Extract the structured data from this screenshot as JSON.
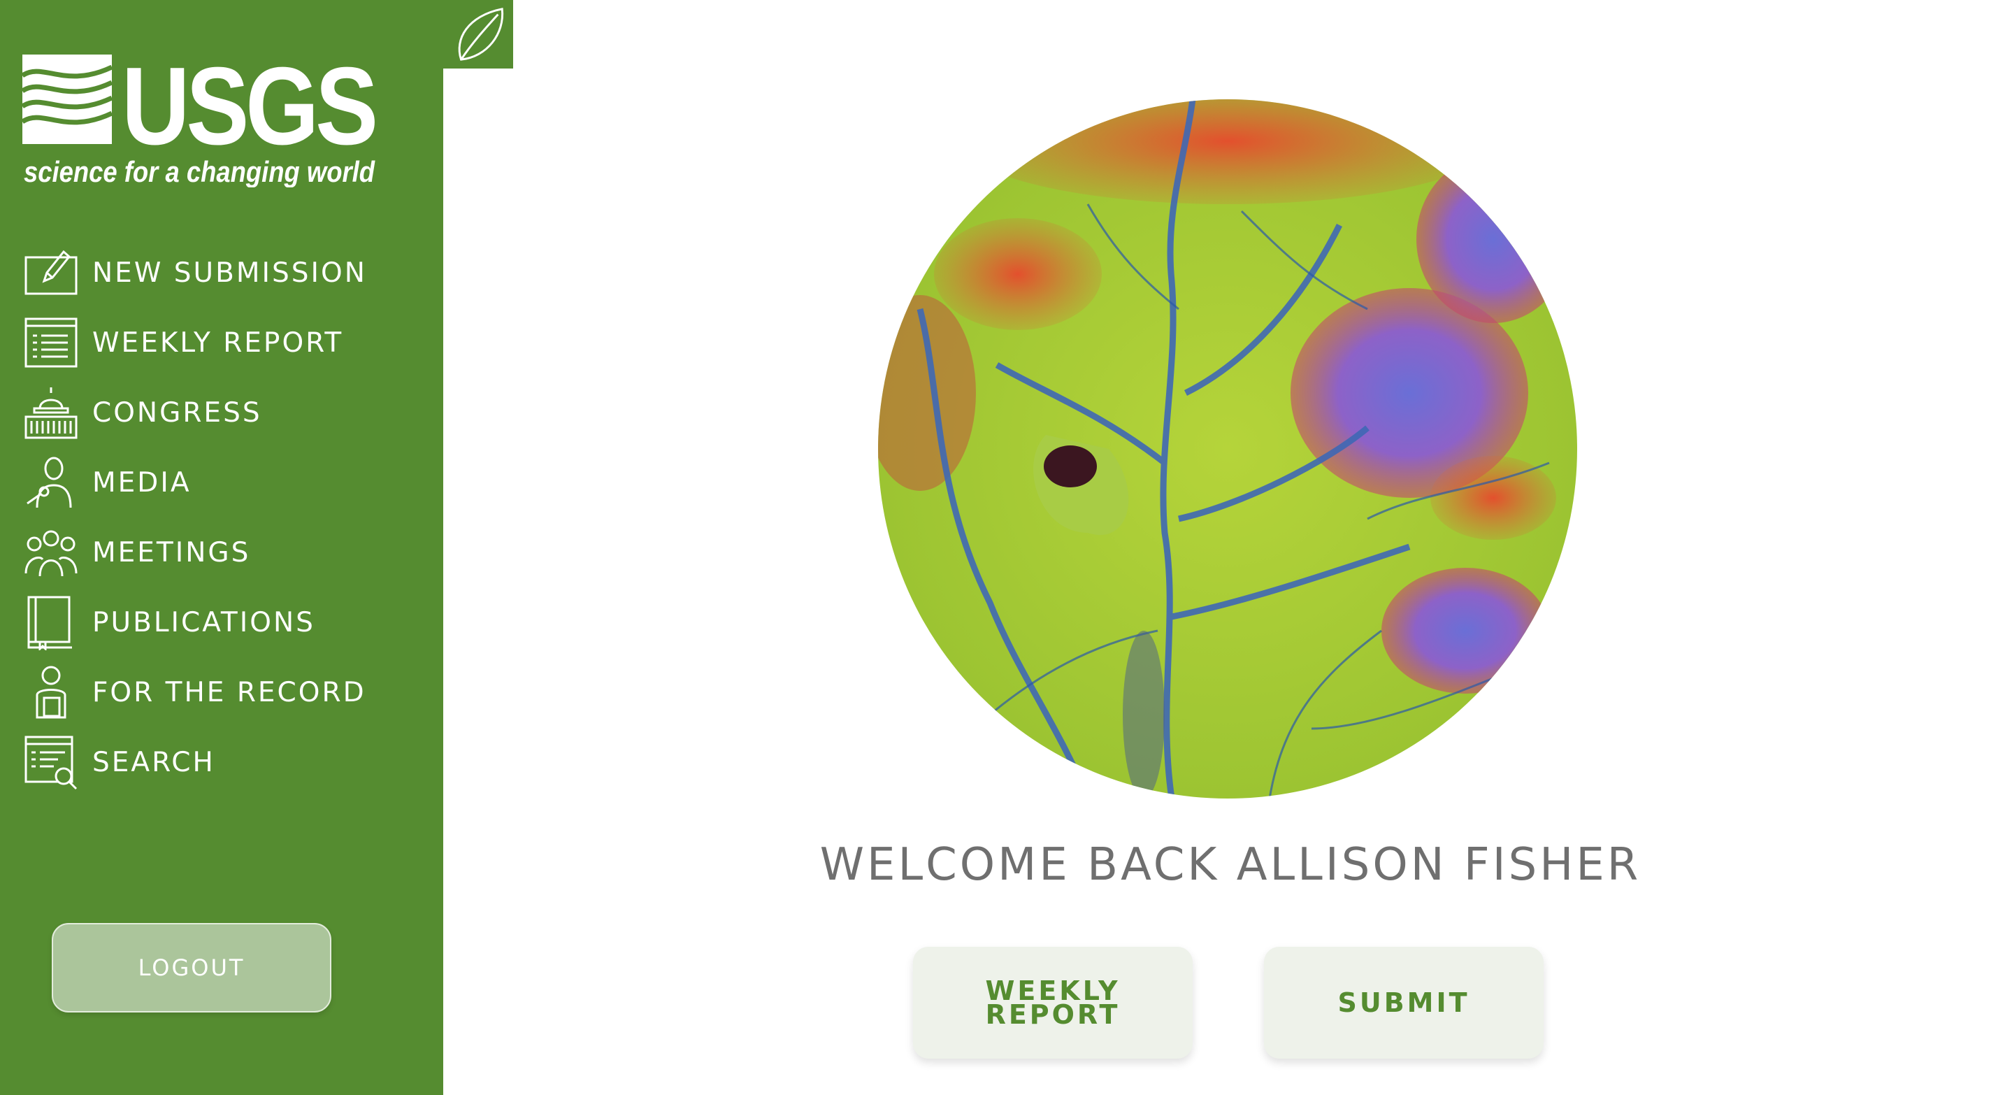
{
  "brand": {
    "logo_text": "USGS",
    "tagline": "science for a changing world",
    "color": "#558c30"
  },
  "sidebar": {
    "items": [
      {
        "label": "NEW SUBMISSION",
        "icon": "edit-icon"
      },
      {
        "label": "WEEKLY REPORT",
        "icon": "report-list-icon"
      },
      {
        "label": "CONGRESS",
        "icon": "capitol-icon"
      },
      {
        "label": "MEDIA",
        "icon": "person-microphone-icon"
      },
      {
        "label": "MEETINGS",
        "icon": "group-icon"
      },
      {
        "label": "PUBLICATIONS",
        "icon": "book-icon"
      },
      {
        "label": "FOR THE RECORD",
        "icon": "person-record-icon"
      },
      {
        "label": "SEARCH",
        "icon": "document-search-icon"
      }
    ],
    "logout_label": "LOGOUT"
  },
  "top_tab": {
    "icon": "leaf-icon"
  },
  "main": {
    "welcome_text": "WELCOME BACK ALLISON FISHER",
    "buttons": {
      "weekly_report": "WEEKLY REPORT",
      "submit": "SUBMIT"
    }
  }
}
